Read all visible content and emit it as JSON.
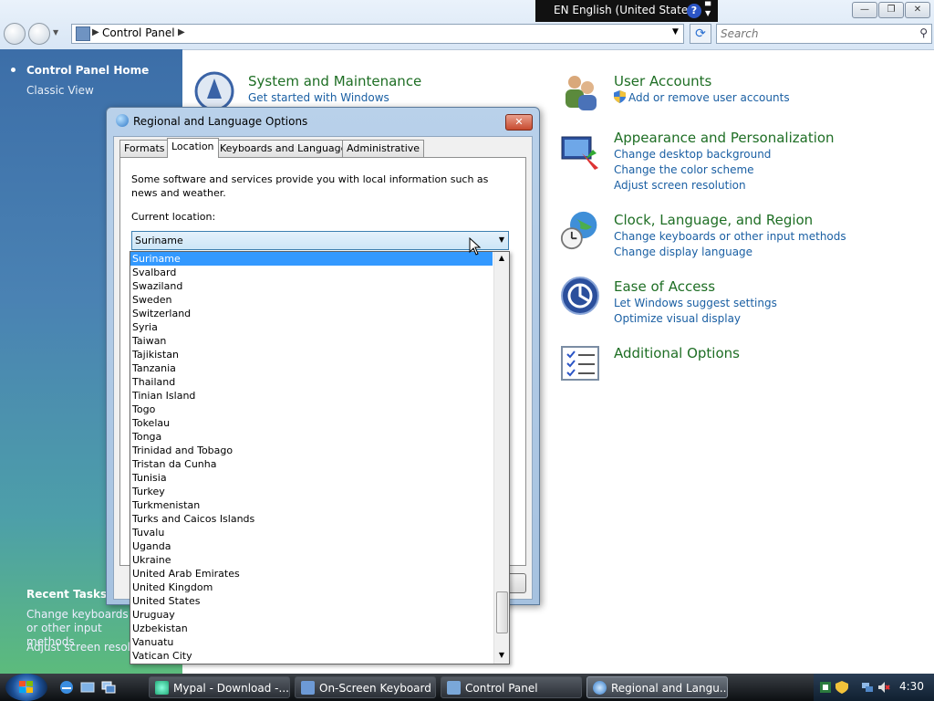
{
  "address": {
    "path": "Control Panel"
  },
  "search": {
    "placeholder": "Search"
  },
  "langbar": {
    "text": "EN English (United States)",
    "help": "?"
  },
  "window_controls": {
    "minimize": "—",
    "maximize": "❐",
    "close": "✕"
  },
  "sidebar": {
    "home": "Control Panel Home",
    "classic": "Classic View",
    "recent_title": "Recent Tasks",
    "recent_1": "Change keyboards or other input methods",
    "recent_2": "Adjust screen resolution"
  },
  "categories": {
    "system": {
      "title": "System and Maintenance",
      "link1": "Get started with Windows"
    },
    "users": {
      "title": "User Accounts",
      "link1": "Add or remove user accounts"
    },
    "appearance": {
      "title": "Appearance and Personalization",
      "link1": "Change desktop background",
      "link2": "Change the color scheme",
      "link3": "Adjust screen resolution"
    },
    "clock": {
      "title": "Clock, Language, and Region",
      "link1": "Change keyboards or other input methods",
      "link2": "Change display language"
    },
    "ease": {
      "title": "Ease of Access",
      "link1": "Let Windows suggest settings",
      "link2": "Optimize visual display"
    },
    "additional": {
      "title": "Additional Options"
    }
  },
  "dialog": {
    "title": "Regional and Language Options",
    "close": "✕",
    "tabs": [
      "Formats",
      "Location",
      "Keyboards and Languages",
      "Administrative"
    ],
    "info": "Some software and services provide you with local information such as news and weather.",
    "current_label": "Current location:",
    "current_value": "Suriname"
  },
  "countries": [
    "Suriname",
    "Svalbard",
    "Swaziland",
    "Sweden",
    "Switzerland",
    "Syria",
    "Taiwan",
    "Tajikistan",
    "Tanzania",
    "Thailand",
    "Tinian Island",
    "Togo",
    "Tokelau",
    "Tonga",
    "Trinidad and Tobago",
    "Tristan da Cunha",
    "Tunisia",
    "Turkey",
    "Turkmenistan",
    "Turks and Caicos Islands",
    "Tuvalu",
    "Uganda",
    "Ukraine",
    "United Arab Emirates",
    "United Kingdom",
    "United States",
    "Uruguay",
    "Uzbekistan",
    "Vanuatu",
    "Vatican City"
  ],
  "taskbar": {
    "tasks": [
      "Mypal - Download -...",
      "On-Screen Keyboard",
      "Control Panel",
      "Regional and Langu..."
    ],
    "clock": "4:30"
  }
}
